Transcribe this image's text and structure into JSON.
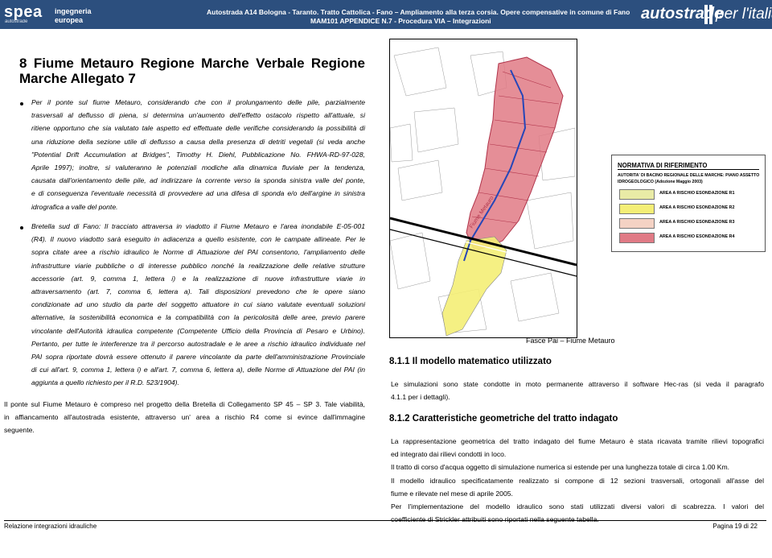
{
  "header": {
    "logo_spea": "spea",
    "logo_spea_sub": "autostrade",
    "logo_ing_1": "ingegneria",
    "logo_ing_2": "europea",
    "title_line1": "Autostrada A14 Bologna - Taranto. Tratto Cattolica - Fano – Ampliamento alla terza corsia. Opere compensative in comune di Fano",
    "title_line2": "MAM101 APPENDICE N.7 - Procedura VIA – Integrazioni",
    "logo_autostrade": "autostrade",
    "logo_italia": "per l'italia",
    "colors": {
      "header_bg": "#2c4f7e",
      "risk_red": "#e07a85"
    }
  },
  "section_title_l1": "8 Fiume Metauro Regione Marche Verbale Regione",
  "section_title_l2": "Marche Allegato 7",
  "bullet1": [
    "Per il ponte sul fiume Metauro, considerando che con il prolungamento delle pile, parzialmente",
    "trasversali al deflusso di piena, si determina un'aumento dell'effetto ostacolo rispetto all'attuale, si",
    "ritiene opportuno che sia valutato tale aspetto ed effettuate delle verifiche considerando la possibilità di",
    "una riduzione della sezione utile di deflusso a causa della presenza di detriti vegetali (si veda anche",
    "\"Potential Drift Accumulation at Bridges\", Timothy H. Diehl, Pubblicazione No. FHWA-RD-97-028,",
    "Aprile 1997); inoltre, si valuteranno le potenziali modiche alla dinamica fluviale per la tendenza,",
    "causata dall'orientamento delle pile, ad indirizzare la corrente verso la sponda sinistra valle del ponte,",
    "e di conseguenza l'eventuale necessità di provvedere ad una difesa di sponda e/o dell'argine in sinistra",
    "idrografica a valle del ponte."
  ],
  "bullet2": [
    "Bretella sud di Fano: Il tracciato attraversa in viadotto il Fiume Metauro e l'area inondabile E-05-001",
    "(R4). Il nuovo viadotto sarà eseguito in adiacenza a quello esistente, con le campate allineate. Per le",
    "sopra citate aree a rischio idraulico le Norme di Attuazione del PAI consentono, l'ampliamento delle",
    "infrastrutture viarie pubbliche o di interesse pubblico nonché la realizzazione delle relative strutture",
    "accessorie (art. 9, comma 1, lettera i) e la realizzazione di nuove infrastrutture viarie in",
    "attraversamento (art. 7, comma 6, lettera a). Tali disposizioni prevedono che le opere siano",
    "condizionate ad uno studio da parte del soggetto attuatore in cui siano valutate eventuali soluzioni",
    "alternative, la sostenibilità economica e la compatibilità con la pericolosità delle aree, previo parere",
    "vincolante dell'Autorità idraulica competente (Competente Ufficio della Provincia di Pesaro e Urbino).",
    "Pertanto, per tutte le interferenze tra il percorso autostradale e le aree a rischio idraulico individuate nel",
    "PAI sopra riportate dovrà essere ottenuto il parere vincolante da parte dell'amministrazione Provinciale",
    "di cui all'art. 9, comma 1, lettera i) e all'art. 7, comma 6, lettera a), delle Norme di Attuazione del PAI (in",
    "aggiunta a quello richiesto per il R.D. 523/1904)."
  ],
  "closing_para": [
    "Il ponte sul Fiume Metauro è compreso nel progetto della Bretella di Collegamento SP 45 – SP 3. Tale viabilità,",
    "in affiancamento all'autostrada esistente, attraverso un' area a rischio R4 come si evince dall'immagine",
    "seguente."
  ],
  "map": {
    "river_label": "Fiume Metauro"
  },
  "legend": {
    "title": "NORMATIVA DI RIFERIMENTO",
    "subtitle_1": "AUTORITA' DI BACINO REGIONALE DELLE MARCHE: PIANO ASSETTO",
    "subtitle_2": "IDROGEOLOGICO (Adozione Maggio 2003)",
    "items": [
      {
        "label": "AREA A RISCHIO ESONDAZIONE R1",
        "color": "#e9eba6"
      },
      {
        "label": "AREA A RISCHIO ESONDAZIONE R2",
        "color": "#f4ee76"
      },
      {
        "label": "AREA A RISCHIO ESONDAZIONE R3",
        "color": "#f4d2c4"
      },
      {
        "label": "AREA A RISCHIO ESONDAZIONE R4",
        "color": "#e07a85"
      }
    ]
  },
  "caption": "Fasce Pai – Fiume Metauro",
  "h_811": "8.1.1 Il modello matematico utilizzato",
  "p_811": [
    "Le simulazioni sono state condotte in moto permanente attraverso il software Hec-ras (si veda il paragrafo",
    "4.1.1 per i dettagli)."
  ],
  "h_812": "8.1.2 Caratteristiche geometriche del tratto indagato",
  "p_812": [
    "La rappresentazione geometrica del tratto indagato del fiume Metauro è stata ricavata tramite rilievi topografici",
    "ed integrato dai rilievi condotti in loco.",
    "Il tratto di corso d'acqua oggetto di simulazione numerica si estende per una lunghezza totale di circa 1.00 Km.",
    "Il modello idraulico specificatamente realizzato si compone di 12 sezioni trasversali, ortogonali all'asse del",
    "fiume e rilevate nel mese di aprile 2005.",
    "Per l'implementazione del modello idraulico sono stati utilizzati diversi valori di scabrezza. I valori del",
    "coefficiente di Strickler attribuiti sono riportati nella seguente tabella."
  ],
  "footer": {
    "left": "Relazione integrazioni idrauliche",
    "right": "Pagina 19 di 22"
  }
}
